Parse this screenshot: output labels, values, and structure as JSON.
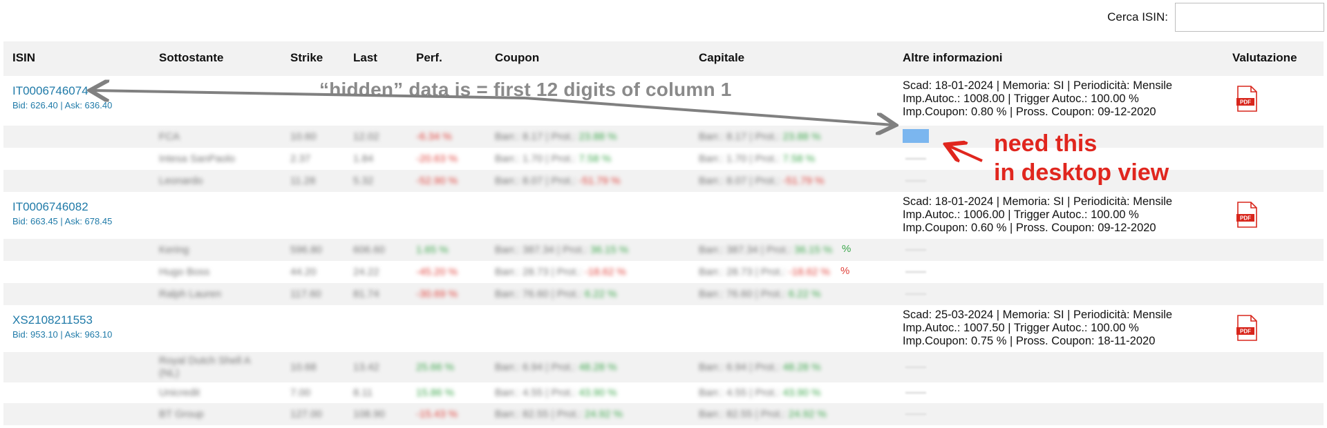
{
  "search": {
    "label": "Cerca ISIN:",
    "value": "",
    "placeholder": ""
  },
  "headers": {
    "isin": "ISIN",
    "sottostante": "Sottostante",
    "strike": "Strike",
    "last": "Last",
    "perf": "Perf.",
    "coupon": "Coupon",
    "capitale": "Capitale",
    "altre": "Altre informazioni",
    "valutazione": "Valutazione"
  },
  "products": [
    {
      "isin": "IT0006746074",
      "bidask": "Bid: 626.40 | Ask: 636.40",
      "info": [
        "Scad: 18-01-2024 | Memoria: SI | Periodicità: Mensile",
        "Imp.Autoc.: 1008.00 | Trigger Autoc.: 100.00 %",
        "Imp.Coupon: 0.80 % | Pross. Coupon: 09-12-2020"
      ],
      "pdf": "PDF",
      "rows": [
        {
          "name": "FCA",
          "strike": "10.60",
          "last": "12.02",
          "perf": "-6.34 %",
          "coupon_bar": "Barr.: 8.17 | Prot.:",
          "coupon_prot": "23.88 %",
          "cap_bar": "Barr.: 8.17 | Prot.:",
          "cap_prot": "23.88 %"
        },
        {
          "name": "Intesa SanPaolo",
          "strike": "2.37",
          "last": "1.84",
          "perf": "-20.63 %",
          "coupon_bar": "Barr.: 1.70 | Prot.:",
          "coupon_prot": "7.58 %",
          "cap_bar": "Barr.: 1.70 | Prot.:",
          "cap_prot": "7.58 %"
        },
        {
          "name": "Leonardo",
          "strike": "11.28",
          "last": "5.32",
          "perf": "-52.90 %",
          "coupon_bar": "Barr.: 8.07 | Prot.:",
          "coupon_prot": "-51.79 %",
          "cap_bar": "Barr.: 8.07 | Prot.:",
          "cap_prot": "-51.79 %"
        }
      ]
    },
    {
      "isin": "IT0006746082",
      "bidask": "Bid: 663.45 | Ask: 678.45",
      "info": [
        "Scad: 18-01-2024 | Memoria: SI | Periodicità: Mensile",
        "Imp.Autoc.: 1006.00 | Trigger Autoc.: 100.00 %",
        "Imp.Coupon: 0.60 % | Pross. Coupon: 09-12-2020"
      ],
      "pdf": "PDF",
      "rows": [
        {
          "name": "Kering",
          "strike": "596.80",
          "last": "606.60",
          "perf": "1.65 %",
          "coupon_bar": "Barr.: 387.34 | Prot.:",
          "coupon_prot": "36.15 %",
          "cap_bar": "Barr.: 387.34 | Prot.:",
          "cap_prot": "36.15 %"
        },
        {
          "name": "Hugo Boss",
          "strike": "44.20",
          "last": "24.22",
          "perf": "-45.20 %",
          "coupon_bar": "Barr.: 28.73 | Prot.:",
          "coupon_prot": "-18.62 %",
          "cap_bar": "Barr.: 28.73 | Prot.:",
          "cap_prot": "-18.62 %"
        },
        {
          "name": "Ralph Lauren",
          "strike": "117.60",
          "last": "81.74",
          "perf": "-30.69 %",
          "coupon_bar": "Barr.: 76.60 | Prot.:",
          "coupon_prot": "6.22 %",
          "cap_bar": "Barr.: 76.60 | Prot.:",
          "cap_prot": "6.22 %"
        }
      ]
    },
    {
      "isin": "XS2108211553",
      "bidask": "Bid: 953.10 | Ask: 963.10",
      "info": [
        "Scad: 25-03-2024 | Memoria: SI | Periodicità: Mensile",
        "Imp.Autoc.: 1007.50 | Trigger Autoc.: 100.00 %",
        "Imp.Coupon: 0.75 % | Pross. Coupon: 18-11-2020"
      ],
      "pdf": "PDF",
      "rows": [
        {
          "name": "Royal Dutch Shell A (NL)",
          "strike": "10.68",
          "last": "13.42",
          "perf": "25.66 %",
          "coupon_bar": "Barr.: 6.94 | Prot.:",
          "coupon_prot": "48.28 %",
          "cap_bar": "Barr.: 6.94 | Prot.:",
          "cap_prot": "48.28 %"
        },
        {
          "name": "Unicredit",
          "strike": "7.00",
          "last": "8.11",
          "perf": "15.86 %",
          "coupon_bar": "Barr.: 4.55 | Prot.:",
          "coupon_prot": "43.90 %",
          "cap_bar": "Barr.: 4.55 | Prot.:",
          "cap_prot": "43.90 %"
        },
        {
          "name": "BT Group",
          "strike": "127.00",
          "last": "108.90",
          "perf": "-15.43 %",
          "coupon_bar": "Barr.: 82.55 | Prot.:",
          "coupon_prot": "24.92 %",
          "cap_bar": "Barr.: 82.55 | Prot.:",
          "cap_prot": "24.92 %"
        }
      ]
    }
  ],
  "annotations": {
    "hidden": "“hidden” data is = first 12 digits of column 1",
    "need_line1": "need this",
    "need_line2": "in desktop view",
    "pct_glyph": "%"
  },
  "colors": {
    "link": "#1f7aa8",
    "header_bg": "#f2f2f2",
    "negative": "#e0403a",
    "positive": "#3aa64a",
    "annotation_red": "#e0261e",
    "annotation_grey": "#8a8a8a",
    "pdf_red": "#d8261c"
  }
}
